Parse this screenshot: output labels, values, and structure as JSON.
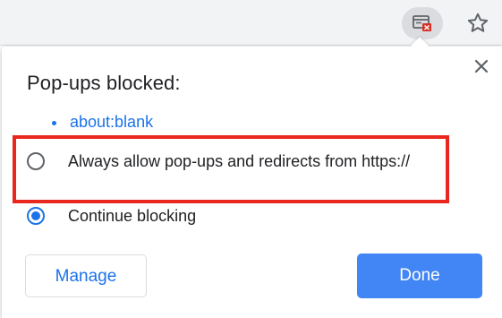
{
  "toolbar": {
    "popup_blocked_icon": "popup-blocked-icon",
    "star_icon": "star-icon"
  },
  "dialog": {
    "title": "Pop-ups blocked:",
    "blocked_links": [
      "about:blank"
    ],
    "options": [
      {
        "label": "Always allow pop-ups and redirects from https://",
        "selected": false
      },
      {
        "label": "Continue blocking",
        "selected": true
      }
    ],
    "manage_label": "Manage",
    "done_label": "Done",
    "close_icon": "close-icon"
  },
  "colors": {
    "accent": "#1a73e8",
    "done_button": "#4285f4",
    "highlight_box": "#e8281f"
  }
}
